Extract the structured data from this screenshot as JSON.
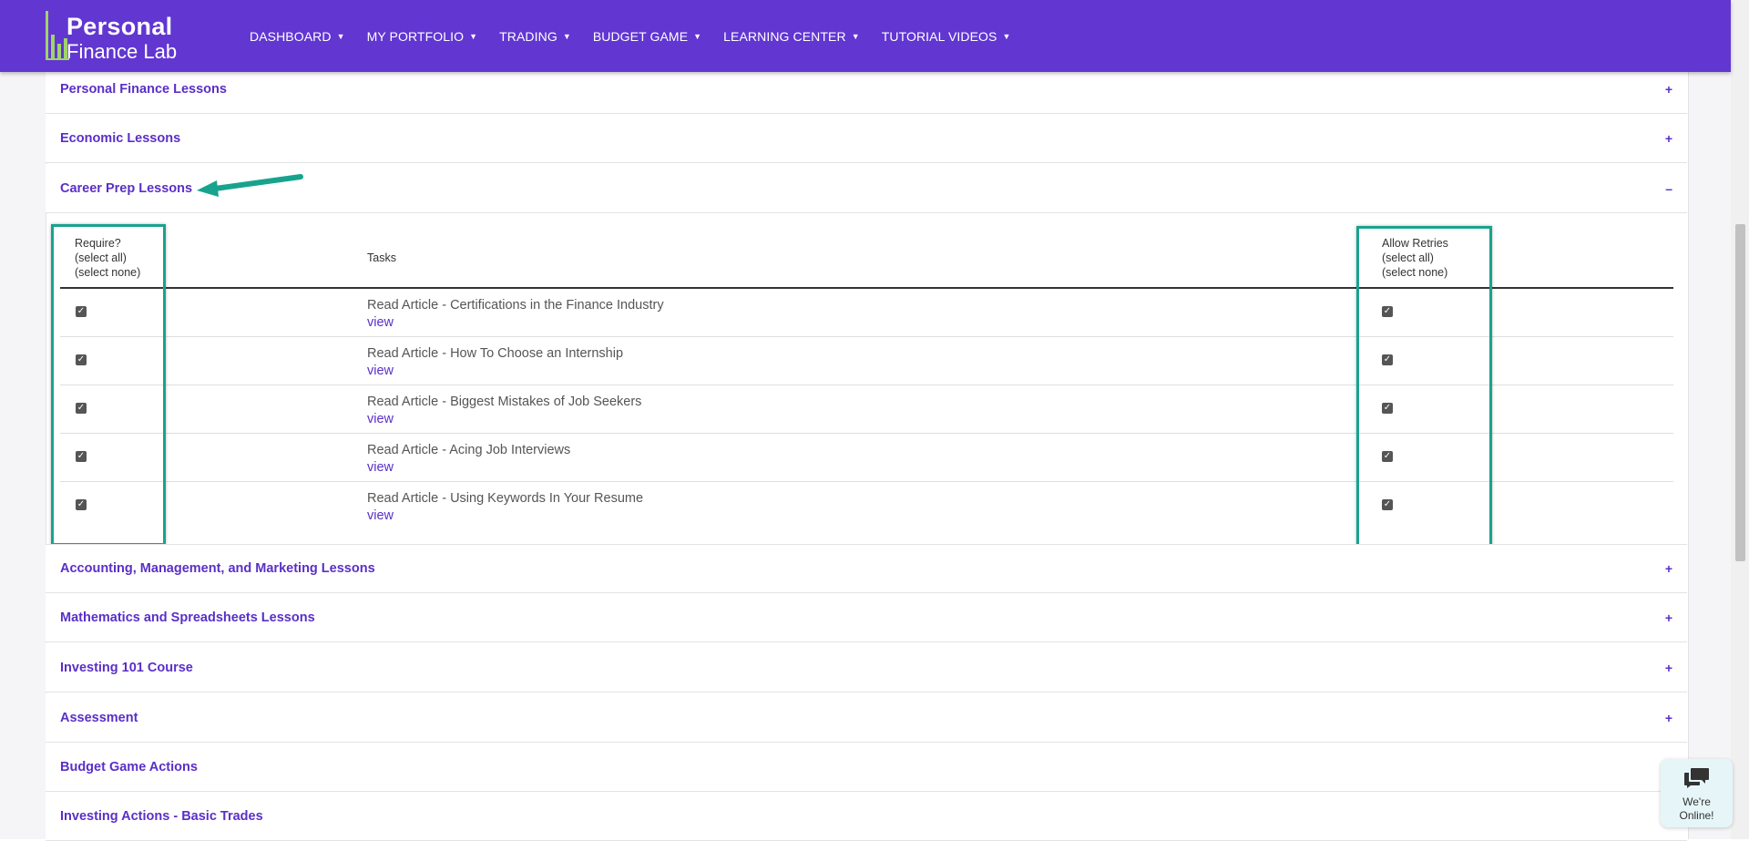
{
  "app": {
    "logo_line1": "Personal",
    "logo_line2": "Finance Lab"
  },
  "nav": {
    "items": [
      {
        "label": "DASHBOARD"
      },
      {
        "label": "MY PORTFOLIO"
      },
      {
        "label": "TRADING"
      },
      {
        "label": "BUDGET GAME"
      },
      {
        "label": "LEARNING CENTER"
      },
      {
        "label": "TUTORIAL VIDEOS"
      }
    ]
  },
  "accordion": {
    "above": [
      {
        "title": "Personal Finance Lessons",
        "toggle": "+"
      },
      {
        "title": "Economic Lessons",
        "toggle": "+"
      },
      {
        "title": "Career Prep Lessons",
        "toggle": "–"
      }
    ],
    "below": [
      {
        "title": "Accounting, Management, and Marketing Lessons",
        "toggle": "+"
      },
      {
        "title": "Mathematics and Spreadsheets Lessons",
        "toggle": "+"
      },
      {
        "title": "Investing 101 Course",
        "toggle": "+"
      },
      {
        "title": "Assessment",
        "toggle": "+"
      },
      {
        "title": "Budget Game Actions",
        "toggle": ""
      },
      {
        "title": "Investing Actions - Basic Trades",
        "toggle": ""
      }
    ]
  },
  "table": {
    "require_header": "Require?",
    "require_select_all": "(select all)",
    "require_select_none": "(select none)",
    "tasks_header": "Tasks",
    "retries_header": "Allow Retries",
    "retries_select_all": "(select all)",
    "retries_select_none": "(select none)",
    "view_label": "view",
    "rows": [
      {
        "task": "Read Article - Certifications in the Finance Industry",
        "require": true,
        "retry": true
      },
      {
        "task": "Read Article - How To Choose an Internship",
        "require": true,
        "retry": true
      },
      {
        "task": "Read Article - Biggest Mistakes of Job Seekers",
        "require": true,
        "retry": true
      },
      {
        "task": "Read Article - Acing Job Interviews",
        "require": true,
        "retry": true
      },
      {
        "task": "Read Article - Using Keywords In Your Resume",
        "require": true,
        "retry": true
      }
    ]
  },
  "chat": {
    "line1": "We're",
    "line2": "Online!"
  },
  "colors": {
    "brand": "#6236d1",
    "link": "#5a2fc7",
    "highlight": "#17a38e"
  }
}
